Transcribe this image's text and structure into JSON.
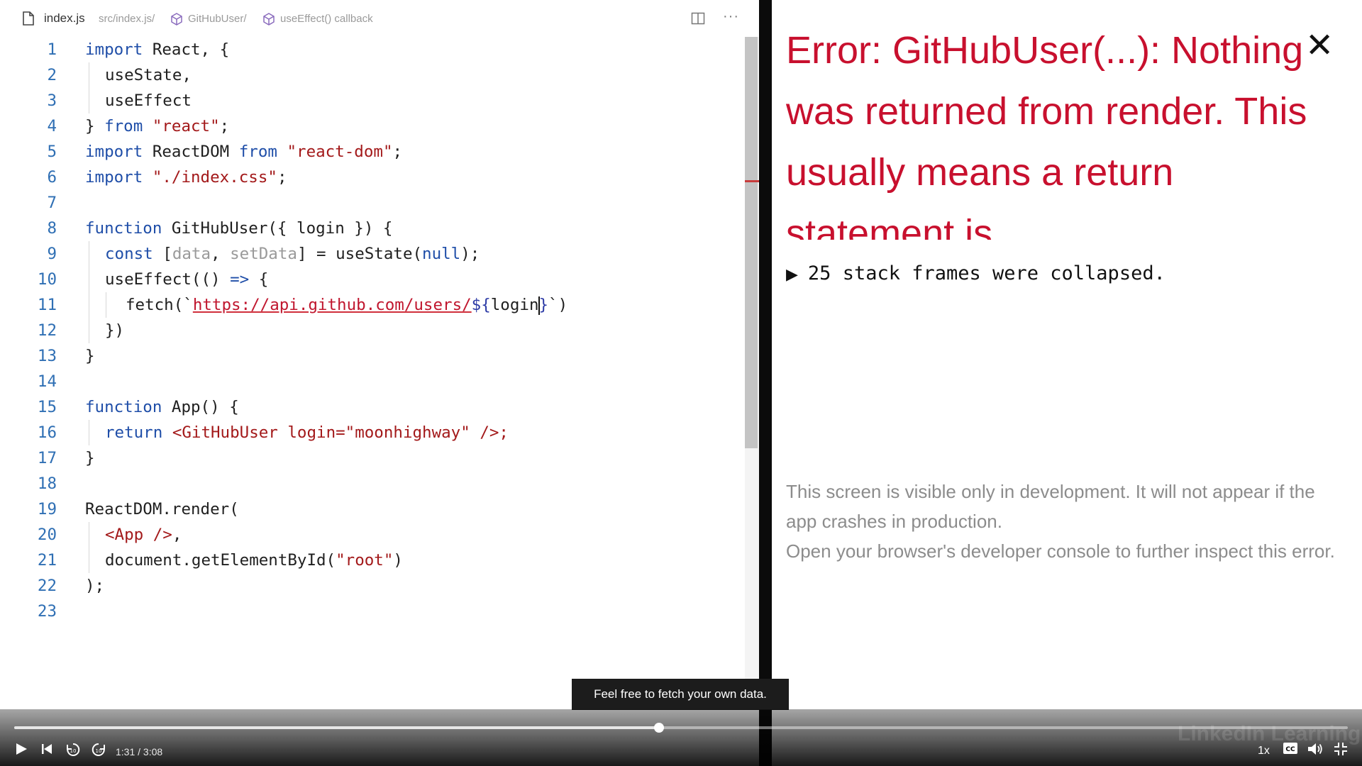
{
  "editor": {
    "breadcrumb": {
      "file": "index.js",
      "path": "src/index.js/",
      "component": "GitHubUser/",
      "callback": "useEffect() callback"
    },
    "lines": [
      {
        "n": "1"
      },
      {
        "n": "2"
      },
      {
        "n": "3"
      },
      {
        "n": "4"
      },
      {
        "n": "5"
      },
      {
        "n": "6"
      },
      {
        "n": "7"
      },
      {
        "n": "8"
      },
      {
        "n": "9"
      },
      {
        "n": "10"
      },
      {
        "n": "11"
      },
      {
        "n": "12"
      },
      {
        "n": "13"
      },
      {
        "n": "14"
      },
      {
        "n": "15"
      },
      {
        "n": "16"
      },
      {
        "n": "17"
      },
      {
        "n": "18"
      },
      {
        "n": "19"
      },
      {
        "n": "20"
      },
      {
        "n": "21"
      },
      {
        "n": "22"
      },
      {
        "n": "23"
      }
    ],
    "code": {
      "l1": {
        "kw": "import",
        "rest": " React, {"
      },
      "l2": "useState,",
      "l3": "useEffect",
      "l4": {
        "pre": "} ",
        "kw": "from",
        "sp": " ",
        "str": "\"react\"",
        "end": ";"
      },
      "l5": {
        "kw1": "import",
        "mid": " ReactDOM ",
        "kw2": "from",
        "sp": " ",
        "str": "\"react-dom\"",
        "end": ";"
      },
      "l6": {
        "kw": "import",
        "sp": " ",
        "str": "\"./index.css\"",
        "end": ";"
      },
      "l8": {
        "kw": "function",
        "rest": " GitHubUser({ login }) {"
      },
      "l9": {
        "kw": "const",
        "a": " [",
        "d1": "data",
        "b": ", ",
        "d2": "setData",
        "c": "] = useState(",
        "nul": "null",
        "e": ");"
      },
      "l10": {
        "a": "useEffect(() ",
        "arrow": "=>",
        "b": " {"
      },
      "l11": {
        "a": "fetch(`",
        "url": "https://api.github.com/users/",
        "tmpl": "${",
        "var": "login",
        "tclose": "}",
        "end": "`)"
      },
      "l12": "})",
      "l13": "}",
      "l15": {
        "kw": "function",
        "rest": " App() {"
      },
      "l16": {
        "kw": "return",
        "sp": " ",
        "tag": "<GitHubUser",
        "attr": " login=",
        "str": "\"moonhighway\"",
        "end": " />;"
      },
      "l17": "}",
      "l19": "ReactDOM.render(",
      "l20": {
        "tag": "<App />",
        "end": ","
      },
      "l21": {
        "a": "document.getElementById(",
        "str": "\"root\"",
        "b": ")"
      },
      "l22": ");"
    }
  },
  "error": {
    "title": "Error: GitHubUser(...): Nothing was returned from render. This usually means a return statement is",
    "stack_frames": "25 stack frames were collapsed.",
    "note_line1": "This screen is visible only in development. It will not appear if the app crashes in production.",
    "note_line2": "Open your browser's developer console to further inspect this error.",
    "close_glyph": "✕"
  },
  "subtitle": "Feel free to fetch your own data.",
  "player": {
    "time": "1:31 / 3:08",
    "progress": 0.4835,
    "speed": "1x",
    "watermark": "LinkedIn Learning"
  }
}
